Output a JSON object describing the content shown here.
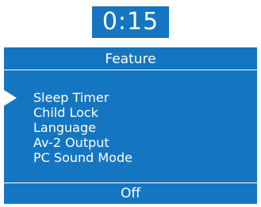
{
  "timer": {
    "display": "0:15"
  },
  "panel": {
    "title": "Feature",
    "items": [
      {
        "label": "Sleep Timer",
        "selected": true
      },
      {
        "label": "Child Lock",
        "selected": false
      },
      {
        "label": "Language",
        "selected": false
      },
      {
        "label": "Av-2 Output",
        "selected": false
      },
      {
        "label": "PC Sound Mode",
        "selected": false
      }
    ],
    "current_value": "Off"
  },
  "colors": {
    "panel_background": "#1476c1",
    "text": "#ffffff",
    "page_background": "#ffffff"
  },
  "icons": {
    "selection_pointer": "triangle-right-icon"
  }
}
